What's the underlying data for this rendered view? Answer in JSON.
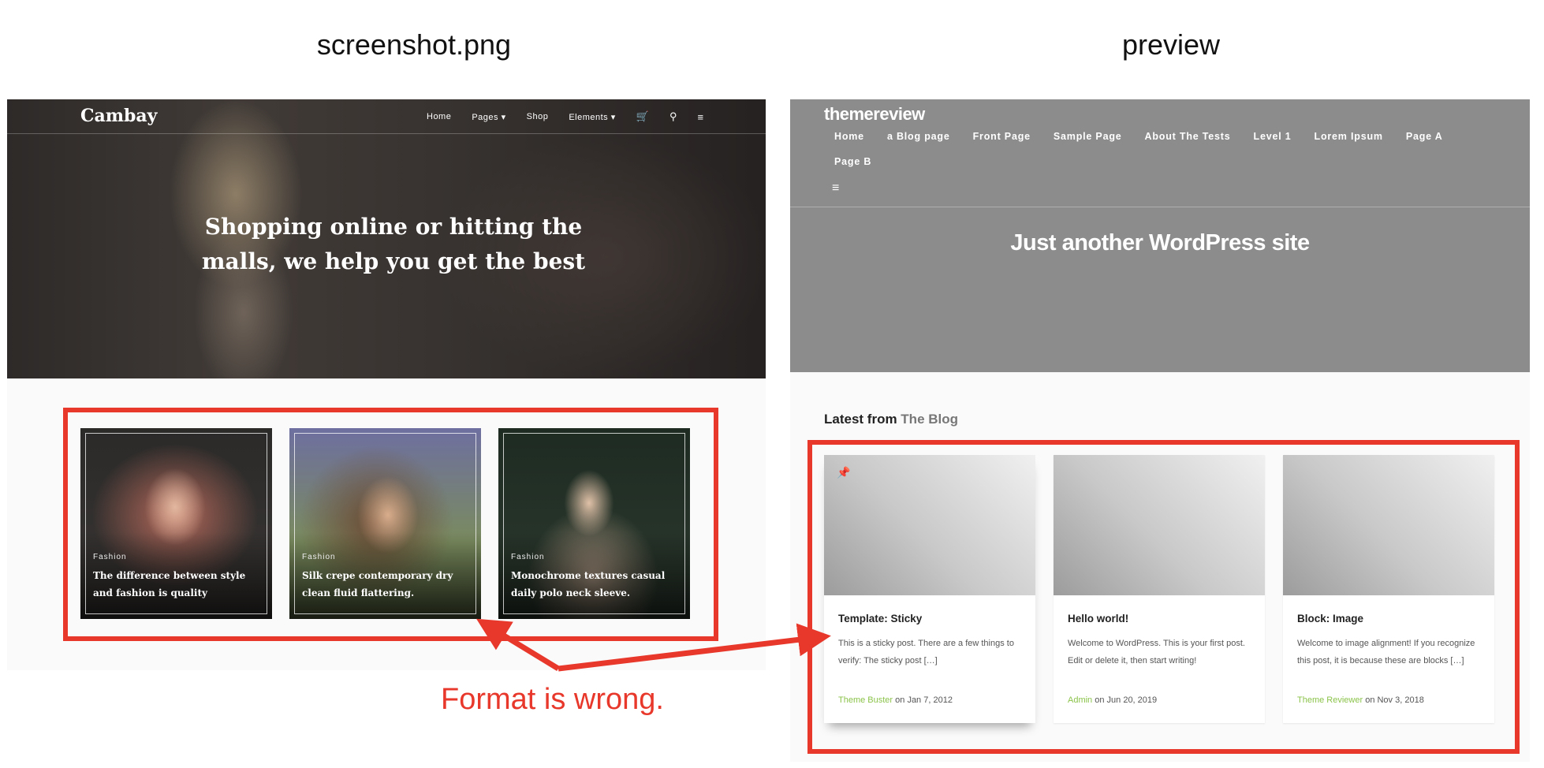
{
  "captions": {
    "left": "screenshot.png",
    "right": "preview"
  },
  "left": {
    "brand": "Cambay",
    "nav": [
      "Home",
      "Pages ▾",
      "Shop",
      "Elements ▾"
    ],
    "nav_icons": [
      "cart-icon",
      "search-icon",
      "menu-icon"
    ],
    "hero_title": "Shopping online or hitting the malls, we help you get the best",
    "cards": [
      {
        "category": "Fashion",
        "title": "The difference between style and fashion is quality"
      },
      {
        "category": "Fashion",
        "title": "Silk crepe contemporary dry clean fluid flattering."
      },
      {
        "category": "Fashion",
        "title": "Monochrome textures casual daily polo neck sleeve."
      }
    ]
  },
  "right": {
    "logo": "themereview",
    "menu": [
      "Home",
      "a Blog page",
      "Front Page",
      "Sample Page",
      "About The Tests",
      "Level 1",
      "Lorem Ipsum",
      "Page A",
      "Page B"
    ],
    "tagline": "Just another WordPress site",
    "section_prefix": "Latest from ",
    "section_accent": "The Blog",
    "posts": [
      {
        "title": "Template: Sticky",
        "excerpt": "This is a sticky post. There are a few things to verify: The sticky post […]",
        "author": "Theme Buster",
        "date": " on Jan 7, 2012"
      },
      {
        "title": "Hello world!",
        "excerpt": "Welcome to WordPress. This is your first post. Edit or delete it, then start writing!",
        "author": "Admin",
        "date": " on Jun 20, 2019"
      },
      {
        "title": "Block: Image",
        "excerpt": "Welcome to image alignment! If you recognize this post, it is because these are blocks […]",
        "author": "Theme Reviewer",
        "date": " on Nov 3, 2018"
      }
    ]
  },
  "annotation": {
    "text": "Format is wrong.",
    "color": "#e8372b"
  }
}
